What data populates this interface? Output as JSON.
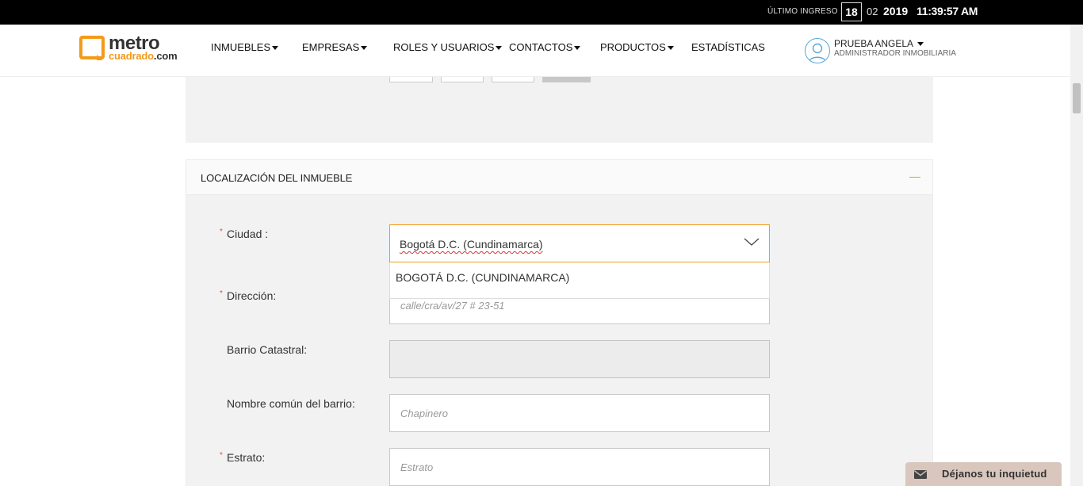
{
  "topbar": {
    "last_login_label": "ÚLTIMO INGRESO",
    "day": "18",
    "month": "02",
    "year": "2019",
    "time": "11:39:57 AM"
  },
  "logo": {
    "metro": "metro",
    "cuadrado": "cuadrado",
    "com": ".com"
  },
  "nav": {
    "items": [
      {
        "label": "INMUEBLES",
        "dropdown": true
      },
      {
        "label": "EMPRESAS",
        "dropdown": true
      },
      {
        "label": "ROLES Y USUARIOS",
        "dropdown": true
      },
      {
        "label": "CONTACTOS",
        "dropdown": true
      },
      {
        "label": "PRODUCTOS",
        "dropdown": true
      },
      {
        "label": "ESTADÍSTICAS",
        "dropdown": false
      }
    ]
  },
  "user": {
    "name": "PRUEBA ANGELA",
    "role": "ADMINISTRADOR INMOBILIARIA"
  },
  "section": {
    "title": "LOCALIZACIÓN DEL INMUEBLE",
    "collapse_icon": "minus-icon"
  },
  "form": {
    "ciudad": {
      "label": "Ciudad :",
      "required": "*",
      "value": "Bogotá D.C. (Cundinamarca)",
      "options": [
        "BOGOTÁ D.C. (CUNDINAMARCA)"
      ]
    },
    "direccion": {
      "label": "Dirección:",
      "required": "*",
      "placeholder": "calle/cra/av/27 # 23-51"
    },
    "barrio_catastral": {
      "label": "Barrio Catastral:"
    },
    "nombre_barrio": {
      "label": "Nombre común del barrio:",
      "placeholder": "Chapinero"
    },
    "estrato": {
      "label": "Estrato:",
      "required": "*",
      "placeholder": "Estrato"
    }
  },
  "feedback": {
    "label": "Déjanos tu inquietud",
    "icon": "envelope-icon"
  },
  "colors": {
    "accent": "#f49a1a",
    "required": "#e0572a",
    "topbar": "#000000",
    "panel": "#f2f2f2"
  }
}
